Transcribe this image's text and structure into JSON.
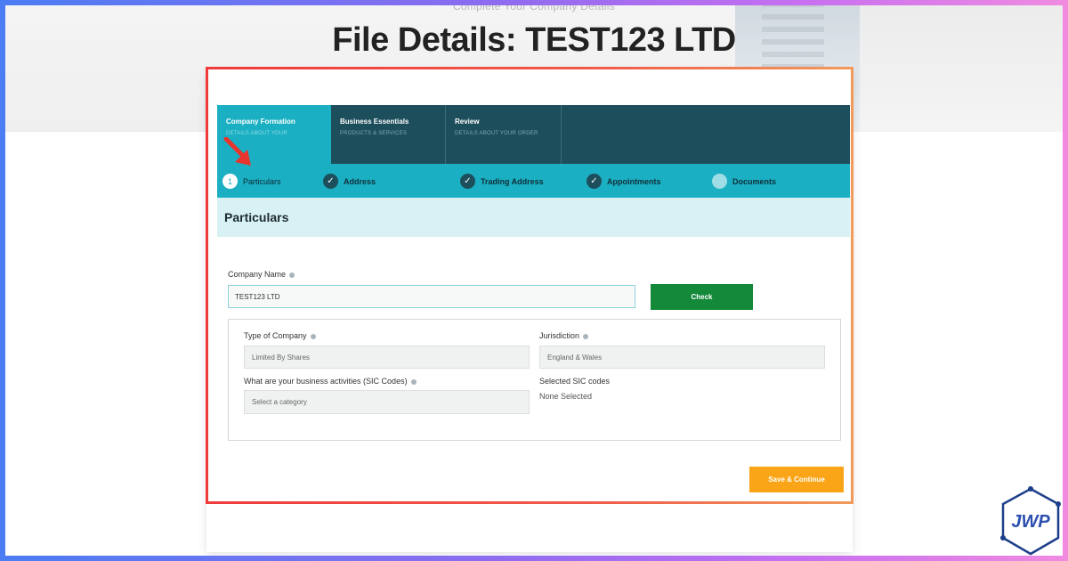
{
  "page": {
    "hero_subtitle": "Complete Your Company Details",
    "title": "File Details: TEST123 LTD"
  },
  "top_steps": [
    {
      "title": "Company Formation",
      "sub": "DETAILS ABOUT YOUR",
      "active": true
    },
    {
      "title": "Business Essentials",
      "sub": "PRODUCTS & SERVICES",
      "active": false
    },
    {
      "title": "Review",
      "sub": "DETAILS ABOUT YOUR ORDER",
      "active": false
    }
  ],
  "sub_steps": [
    {
      "label": "Particulars",
      "state": "current",
      "number": "1"
    },
    {
      "label": "Address",
      "state": "done",
      "mark": "✓"
    },
    {
      "label": "Trading Address",
      "state": "done",
      "mark": "✓"
    },
    {
      "label": "Appointments",
      "state": "done",
      "mark": "✓"
    },
    {
      "label": "Documents",
      "state": "pending",
      "mark": ""
    }
  ],
  "section": {
    "title": "Particulars"
  },
  "form": {
    "company_name_label": "Company Name",
    "company_name_value": "TEST123 LTD",
    "check_label": "Check",
    "type_label": "Type of Company",
    "type_value": "Limited By Shares",
    "jurisdiction_label": "Jurisdiction",
    "jurisdiction_value": "England & Wales",
    "sic_label": "What are your business activities (SIC Codes)",
    "sic_placeholder": "Select a category",
    "selected_sic_label": "Selected SIC codes",
    "selected_sic_value": "None Selected",
    "save_label": "Save & Continue"
  },
  "logo": {
    "text": "JWP"
  },
  "colors": {
    "accent_teal": "#1aafc2",
    "dark_teal": "#1d4e5c",
    "check_green": "#14893a",
    "save_orange": "#f9a517",
    "highlight_red": "#ef3b3b"
  }
}
